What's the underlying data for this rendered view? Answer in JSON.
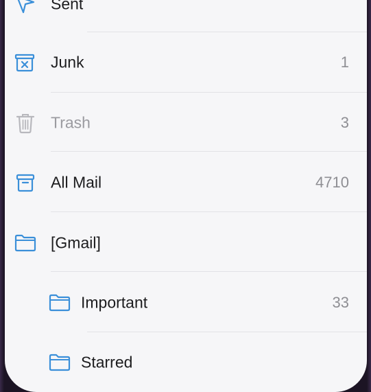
{
  "mailboxes": [
    {
      "label": "Sent",
      "count": "",
      "icon": "paperplane-icon"
    },
    {
      "label": "Junk",
      "count": "1",
      "icon": "junk-box-icon"
    },
    {
      "label": "Trash",
      "count": "3",
      "icon": "trash-icon"
    },
    {
      "label": "All Mail",
      "count": "4710",
      "icon": "archive-box-icon"
    },
    {
      "label": "[Gmail]",
      "count": "",
      "icon": "folder-icon"
    },
    {
      "label": "Important",
      "count": "33",
      "icon": "folder-icon"
    },
    {
      "label": "Starred",
      "count": "",
      "icon": "folder-icon"
    }
  ],
  "colors": {
    "accent": "#3a8fd9",
    "dim_icon": "#b8b8bd",
    "background": "#f6f6f8"
  }
}
